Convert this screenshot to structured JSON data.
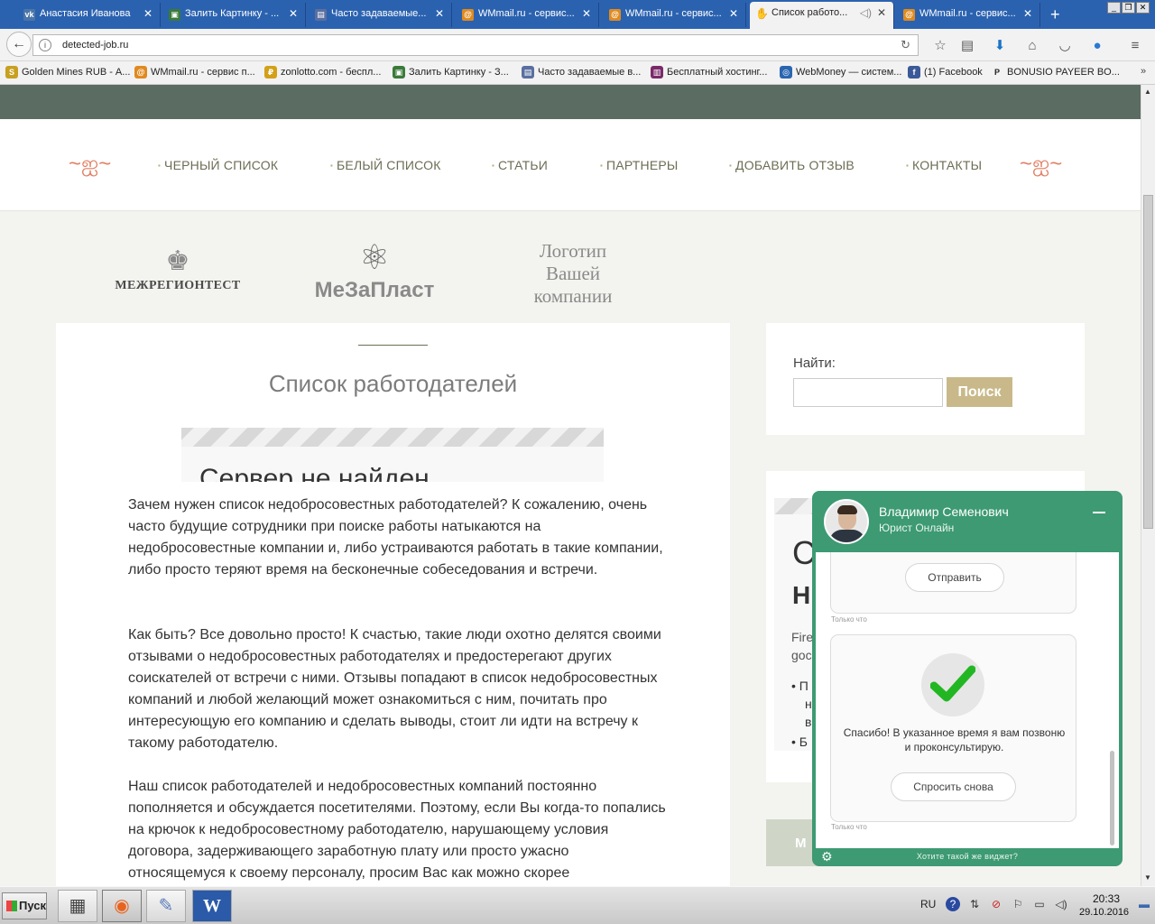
{
  "browser": {
    "tabs": [
      {
        "title": "Анастасия Иванова",
        "icon": "vk-icon",
        "icon_text": "vk",
        "icon_color": "#4a76a8"
      },
      {
        "title": "Залить Картинку - ...",
        "icon": "image-host-icon",
        "icon_text": "▣",
        "icon_color": "#3a7a3a"
      },
      {
        "title": "Часто задаваемые...",
        "icon": "page-icon",
        "icon_text": "▤",
        "icon_color": "#5a6fa0"
      },
      {
        "title": "WMmail.ru - сервис...",
        "icon": "wmmail-icon",
        "icon_text": "@",
        "icon_color": "#e08a1e"
      },
      {
        "title": "WMmail.ru - сервис...",
        "icon": "wmmail-icon",
        "icon_text": "@",
        "icon_color": "#e08a1e"
      },
      {
        "title": "Список работо...",
        "icon": "hand-icon",
        "icon_text": "✋",
        "icon_color": "#f2f2f2",
        "active": true
      },
      {
        "title": "WMmail.ru - сервис...",
        "icon": "wmmail-icon",
        "icon_text": "@",
        "icon_color": "#e08a1e"
      }
    ],
    "url": "detected-job.ru",
    "bookmarks": [
      {
        "label": "Golden Mines RUB - А...",
        "icon": "golden-mines-icon",
        "icon_text": "S",
        "icon_color": "#c8a020"
      },
      {
        "label": "WMmail.ru - сервис п...",
        "icon": "wmmail-icon",
        "icon_text": "@",
        "icon_color": "#e08a1e"
      },
      {
        "label": "zonlotto.com - беспл...",
        "icon": "zonlotto-icon",
        "icon_text": "₽",
        "icon_color": "#d4a017"
      },
      {
        "label": "Залить Картинку - З...",
        "icon": "image-host-icon",
        "icon_text": "▣",
        "icon_color": "#3a7a3a"
      },
      {
        "label": "Часто задаваемые в...",
        "icon": "page-icon",
        "icon_text": "▤",
        "icon_color": "#5a6fa0"
      },
      {
        "label": "Бесплатный хостинг...",
        "icon": "hosting-icon",
        "icon_text": "▥",
        "icon_color": "#7a2a6a"
      },
      {
        "label": "WebMoney — систем...",
        "icon": "webmoney-icon",
        "icon_text": "◎",
        "icon_color": "#2a66b0"
      },
      {
        "label": "(1) Facebook",
        "icon": "facebook-icon",
        "icon_text": "f",
        "icon_color": "#3b5998"
      },
      {
        "label": "BONUSIO PAYEER BO...",
        "icon": "payeer-icon",
        "icon_text": "P",
        "icon_color": "#f2f2f2"
      }
    ]
  },
  "site": {
    "menu": [
      "ЧЕРНЫЙ СПИСОК",
      "БЕЛЫЙ СПИСОК",
      "СТАТЬИ",
      "ПАРТНЕРЫ",
      "ДОБАВИТЬ ОТЗЫВ",
      "КОНТАКТЫ"
    ],
    "logos": {
      "logo1": "МЕЖРЕГИОНТЕСТ",
      "logo2": "МеЗаПласт",
      "logo3_lines": [
        "Логотип",
        "Вашей",
        "компании"
      ]
    },
    "content": {
      "title": "Список работодателей",
      "frame_error": "Сервер не найден",
      "paragraphs": [
        "Зачем нужен список недобросовестных работодателей? К сожалению, очень часто будущие сотрудники при поиске работы натыкаются на недобросовестные компании и, либо устраиваются работать в такие компании, либо просто теряют время на бесконечные собеседования и встречи.",
        "Как быть? Все довольно просто! К счастью, такие люди охотно делятся своими отзывами о недобросовестных работодателях и предостерегают других соискателей от встречи с ними. Отзывы попадают в список недобросовестных компаний и любой желающий может ознакомиться с ним, почитать про интересующую его компанию и сделать выводы, стоит ли идти на встречу к такому работодателю.",
        "Наш список работодателей и недобросовестных компаний постоянно пополняется и обсуждается посетителями. Поэтому, если Вы когда-то попались на крючок к недобросовестному работодателю, нарушающему условия договора, задерживающего заработную плату или просто ужасно относящемуся к своему персоналу, просим Вас как можно скорее"
      ]
    },
    "sidebar": {
      "search_label": "Найти:",
      "search_value": "",
      "search_button": "Поиск",
      "fragments": {
        "big1": "С",
        "big2": "Н",
        "text1": "Fire",
        "text2": "goc",
        "bullet": "• П",
        "n": "н",
        "v": "в",
        "bullet2": "• Б"
      },
      "green_label": "М"
    }
  },
  "chat": {
    "agent_name": "Владимир Семенович",
    "agent_role": "Юрист Онлайн",
    "send_button": "Отправить",
    "time_label": "Только что",
    "thanks": "Спасибо! В указанное время я вам позвоню и проконсультирую.",
    "ask_again_button": "Спросить снова",
    "time_label_2": "Только что",
    "promo": "Хотите такой же виджет?",
    "accent": "#3d9a72"
  },
  "taskbar": {
    "start": "Пуск",
    "apps": [
      {
        "icon": "document-icon",
        "glyph": "▦"
      },
      {
        "icon": "firefox-icon",
        "glyph": "◉"
      },
      {
        "icon": "paint-icon",
        "glyph": "✎"
      },
      {
        "icon": "word-icon",
        "glyph": "W"
      }
    ],
    "language": "RU",
    "time": "20:33",
    "date": "29.10.2016"
  }
}
